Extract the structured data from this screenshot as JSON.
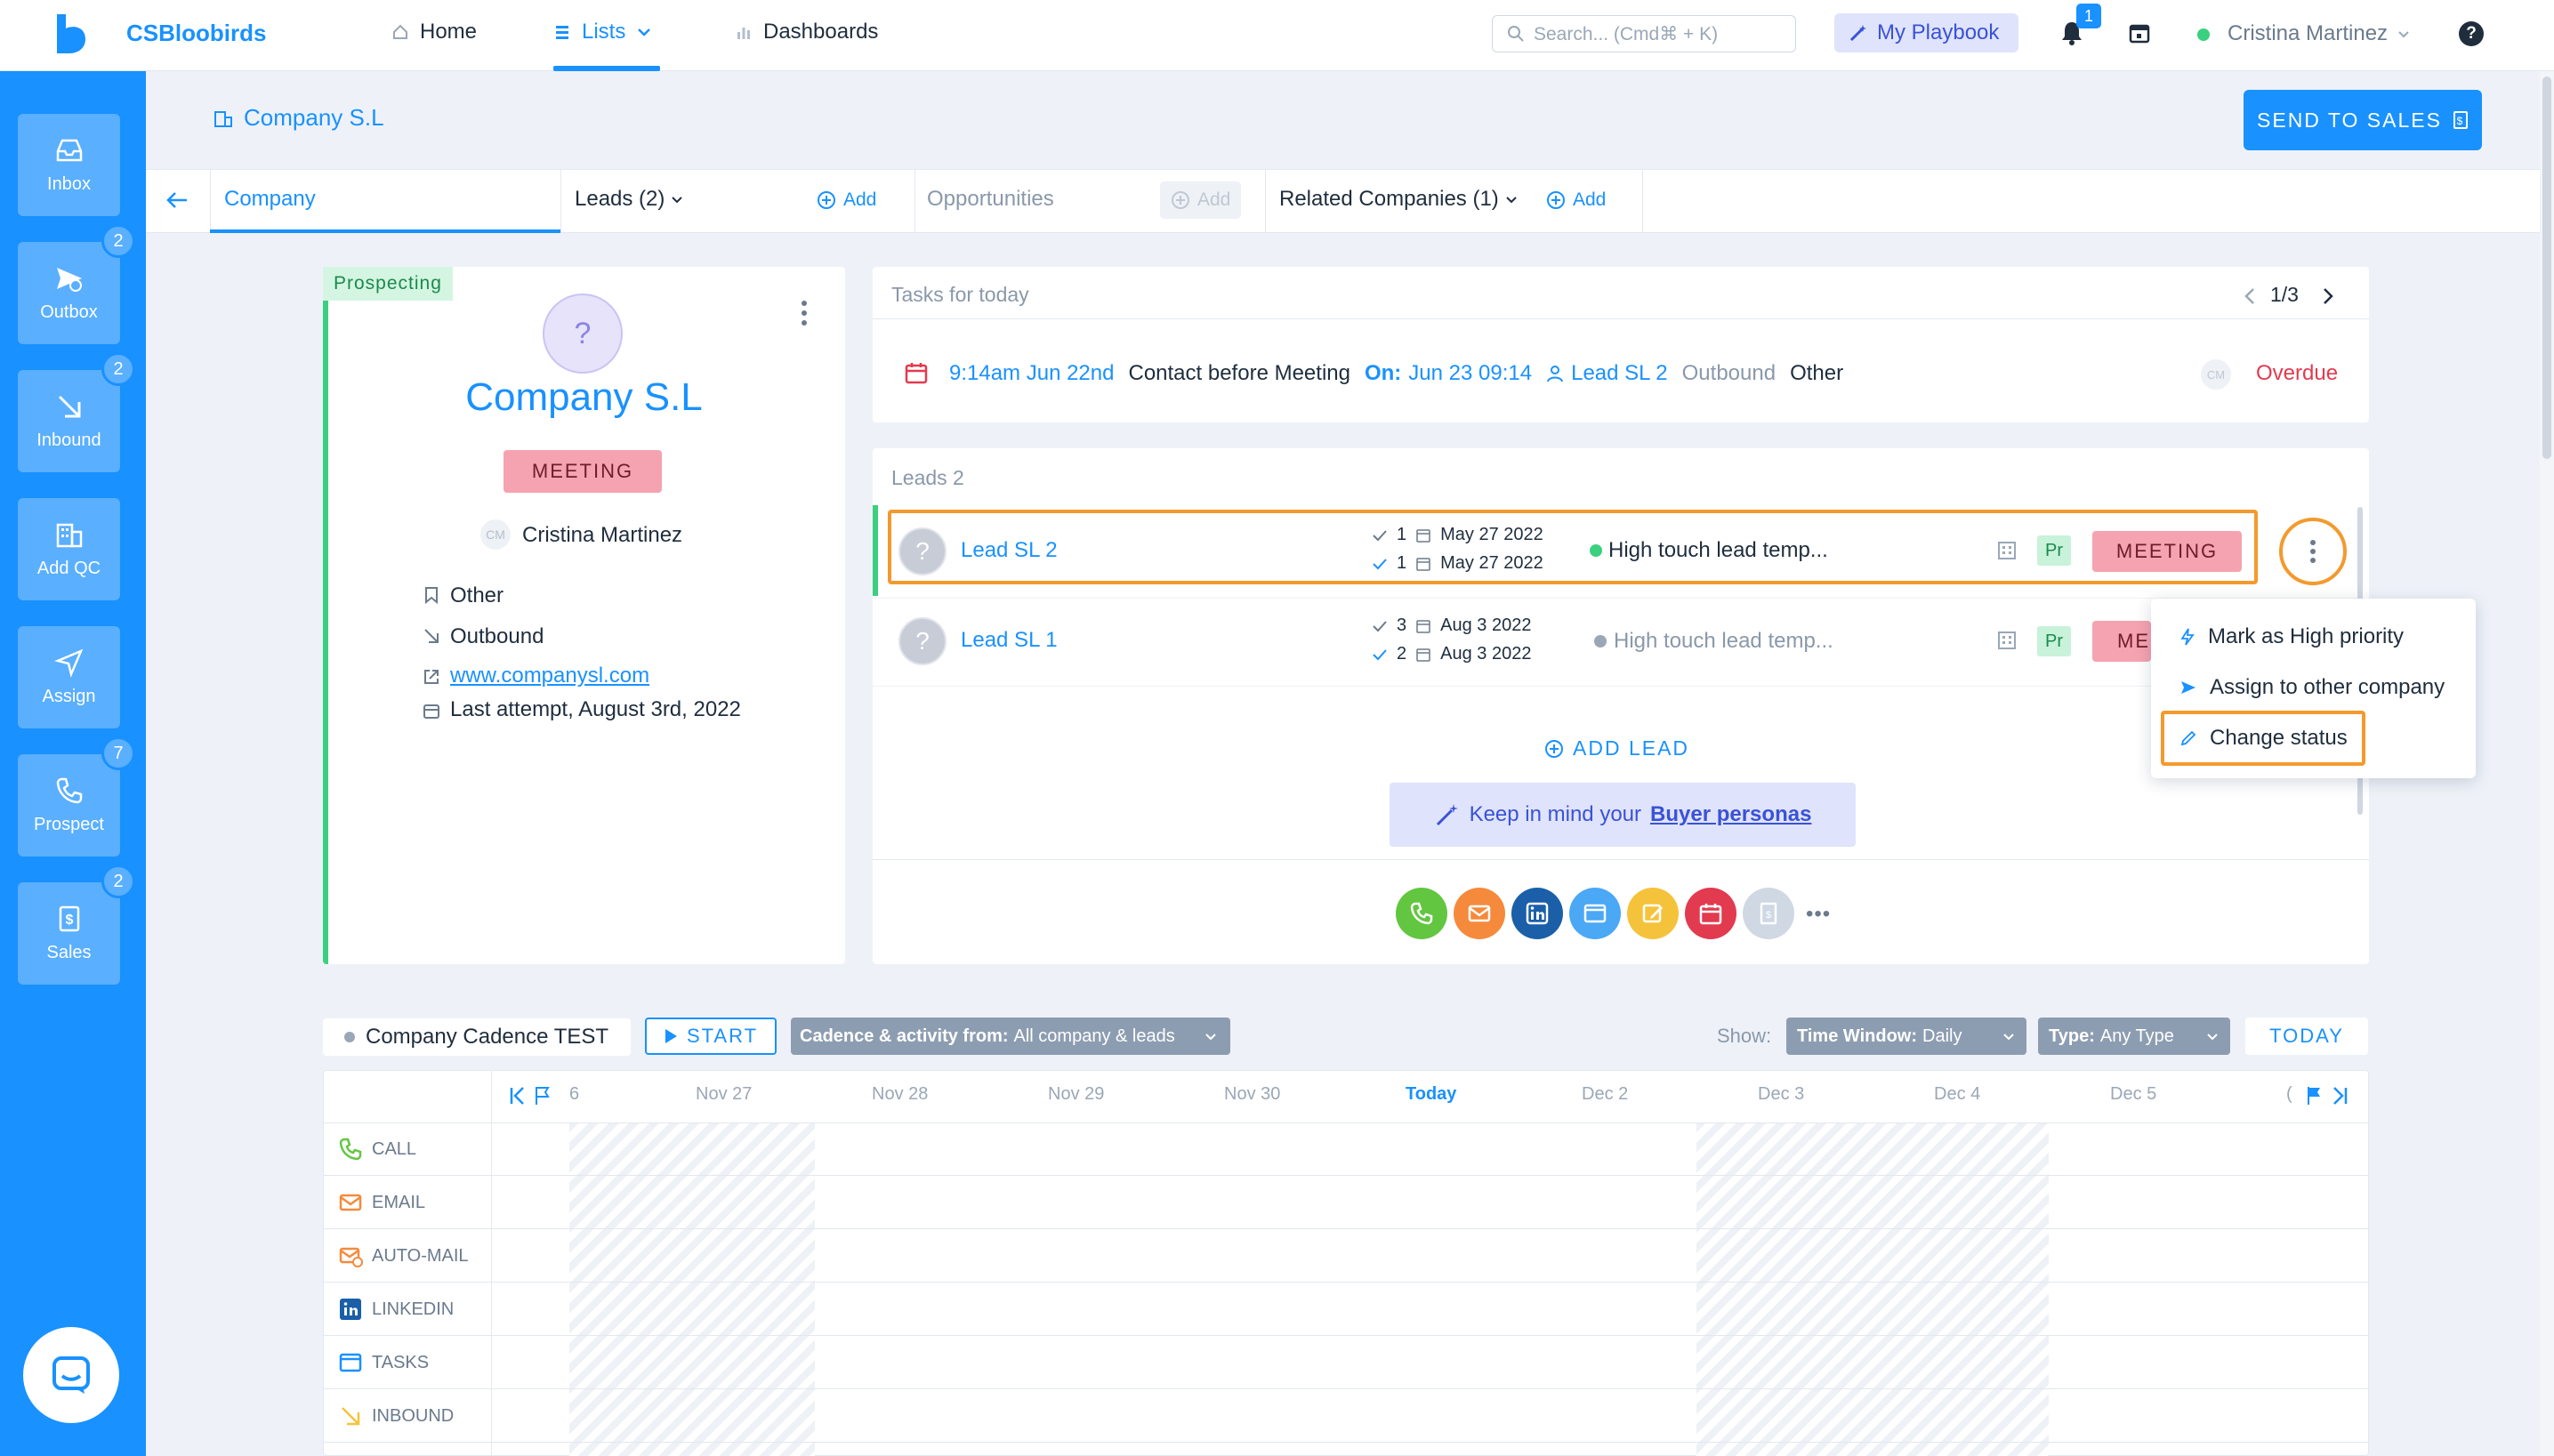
{
  "app": {
    "name": "CSBloobirds"
  },
  "nav": {
    "home": "Home",
    "lists": "Lists",
    "dashboards": "Dashboards"
  },
  "search": {
    "placeholder": "Search... (Cmd⌘ + K)"
  },
  "playbook": {
    "label": "My Playbook"
  },
  "notifications": {
    "count": "1"
  },
  "user": {
    "name": "Cristina Martinez"
  },
  "help": {
    "label": "?"
  },
  "sidebar": {
    "items": [
      {
        "label": "Inbox",
        "badge": ""
      },
      {
        "label": "Outbox",
        "badge": "2"
      },
      {
        "label": "Inbound",
        "badge": "2"
      },
      {
        "label": "Add QC",
        "badge": ""
      },
      {
        "label": "Assign",
        "badge": ""
      },
      {
        "label": "Prospect",
        "badge": "7"
      },
      {
        "label": "Sales",
        "badge": "2"
      }
    ]
  },
  "page": {
    "breadcrumb": "Company S.L",
    "send_to_sales": "SEND TO SALES"
  },
  "tabs": {
    "company": "Company",
    "leads": "Leads (2)",
    "add": "Add",
    "opportunities": "Opportunities",
    "related": "Related Companies (1)"
  },
  "company_card": {
    "stage": "Prospecting",
    "avatar": "?",
    "name": "Company S.L",
    "status": "MEETING",
    "owner": "Cristina Martinez",
    "owner_initials": "CM",
    "source": "Other",
    "direction": "Outbound",
    "website": "www.companysl.com",
    "last_attempt": "Last attempt, August 3rd, 2022"
  },
  "tasks": {
    "title": "Tasks for today",
    "pager": "1/3",
    "task": {
      "time": "9:14am Jun 22nd",
      "description": "Contact before Meeting",
      "on_label": "On:",
      "on_date": "Jun 23 09:14",
      "lead": "Lead SL 2",
      "type": "Outbound",
      "source": "Other",
      "assignee": "CM",
      "status": "Overdue"
    }
  },
  "leads": {
    "title": "Leads 2",
    "rows": [
      {
        "avatar": "?",
        "name": "Lead SL 2",
        "count1": "1",
        "date1": "May 27 2022",
        "count2": "1",
        "date2": "May 27 2022",
        "template": "High touch lead temp...",
        "tag": "Pr",
        "status": "MEETING"
      },
      {
        "avatar": "?",
        "name": "Lead SL 1",
        "count1": "3",
        "date1": "Aug 3 2022",
        "count2": "2",
        "date2": "Aug 3 2022",
        "template": "High touch lead temp...",
        "tag": "Pr",
        "status": "ME"
      }
    ],
    "add_lead": "ADD LEAD",
    "buyer_note": "Keep in mind your",
    "buyer_link": "Buyer personas",
    "more": "•••"
  },
  "context_menu": {
    "items": [
      "Mark as High priority",
      "Assign to other company",
      "Change status"
    ]
  },
  "cadence": {
    "name": "Company Cadence TEST",
    "start": "START",
    "filter_label": "Cadence & activity from:",
    "filter_value": "All company & leads",
    "show": "Show:",
    "time_window_label": "Time Window:",
    "time_window_value": "Daily",
    "type_label": "Type:",
    "type_value": "Any Type",
    "today_button": "TODAY",
    "days": [
      "6",
      "Nov 27",
      "Nov 28",
      "Nov 29",
      "Nov 30",
      "Today",
      "Dec 2",
      "Dec 3",
      "Dec 4",
      "Dec 5",
      "("
    ],
    "rows": [
      "CALL",
      "EMAIL",
      "AUTO-MAIL",
      "LINKEDIN",
      "TASKS",
      "INBOUND"
    ]
  },
  "colors": {
    "primary": "#1991ff",
    "meeting_pink": "#f5a3b0",
    "overdue_red": "#e23a4f",
    "highlight_orange": "#f39a2e",
    "prospecting_green": "#3ad07f"
  }
}
